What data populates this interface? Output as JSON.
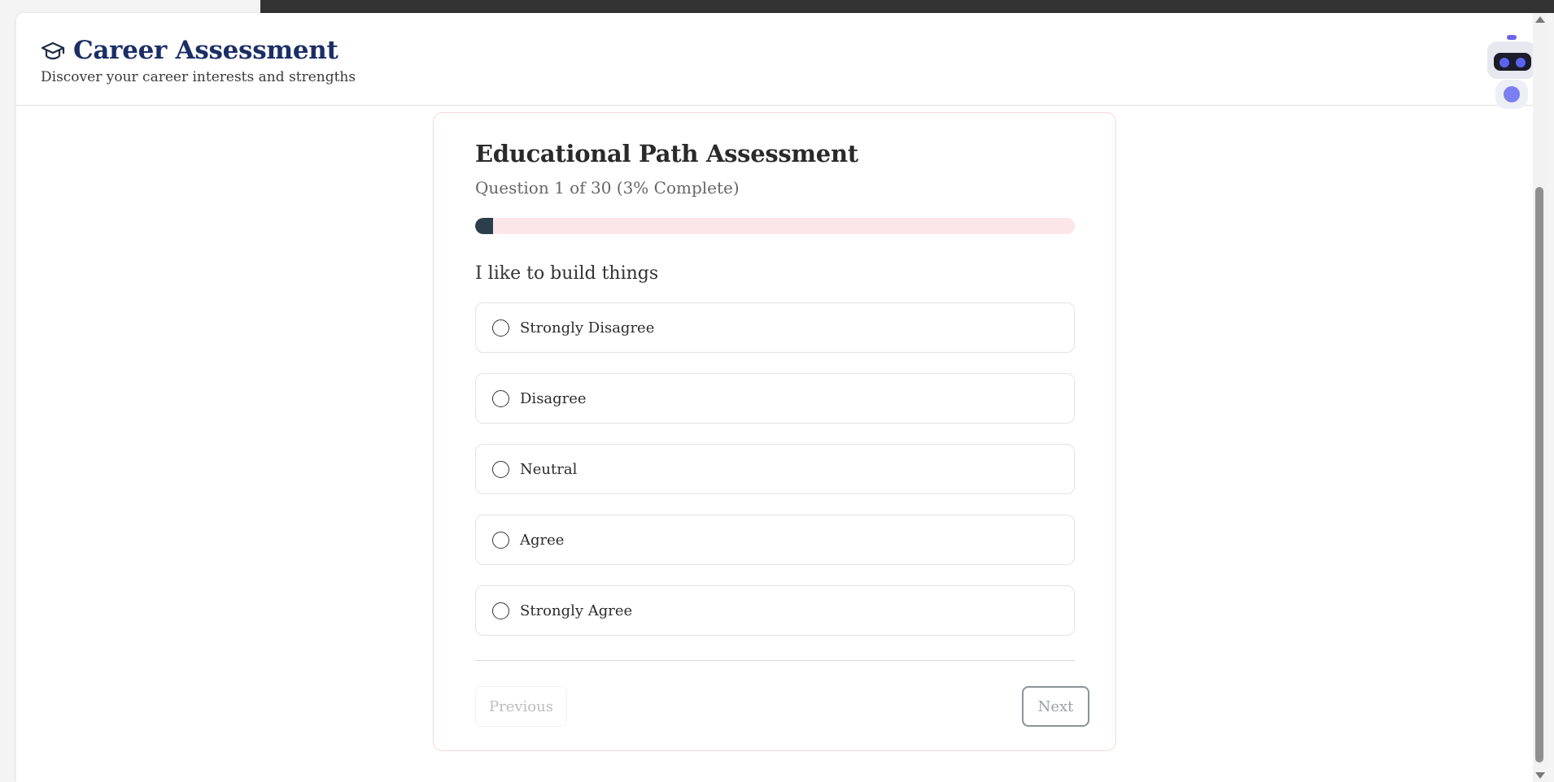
{
  "header": {
    "icon": "graduation-cap-icon",
    "title": "Career Assessment",
    "subtitle": "Discover your career interests and strengths"
  },
  "assessment": {
    "title": "Educational Path Assessment",
    "counter": "Question 1 of 30 (3% Complete)",
    "progress_percent": 3,
    "question": "I like to build things",
    "options": [
      {
        "label": "Strongly Disagree",
        "selected": false
      },
      {
        "label": "Disagree",
        "selected": false
      },
      {
        "label": "Neutral",
        "selected": false
      },
      {
        "label": "Agree",
        "selected": false
      },
      {
        "label": "Strongly Agree",
        "selected": false
      }
    ],
    "previous_label": "Previous",
    "next_label": "Next"
  },
  "assistant": {
    "icon": "robot-assistant-icon"
  },
  "colors": {
    "brand_title": "#1c2e66",
    "progress_fill": "#2d3e4b",
    "progress_track": "#fde6e8",
    "card_border": "#f7d6db"
  }
}
